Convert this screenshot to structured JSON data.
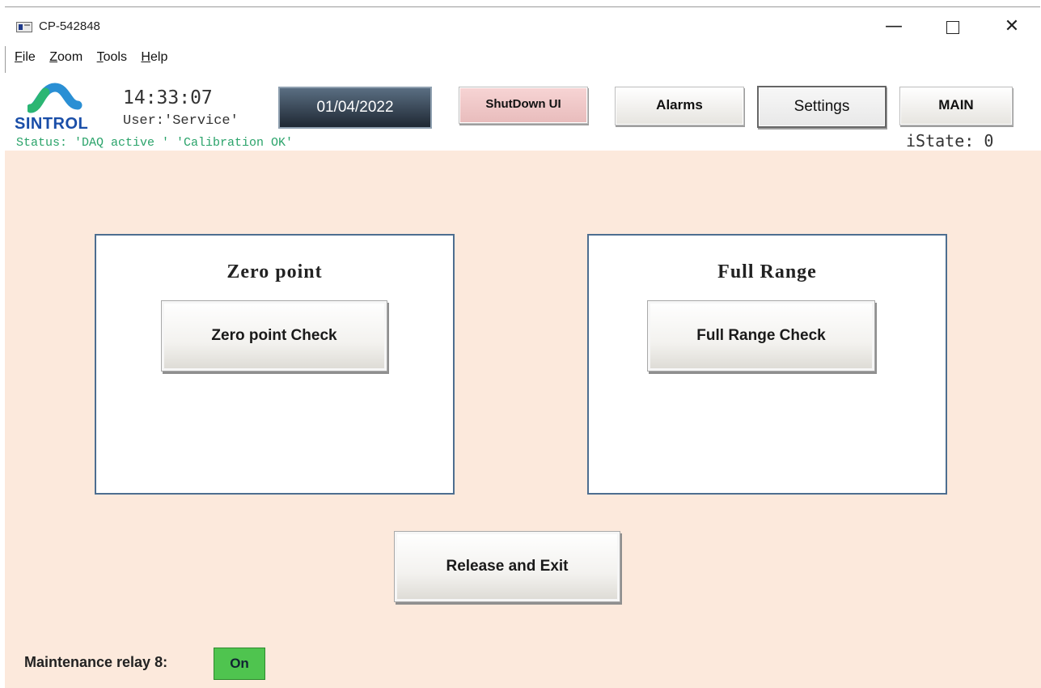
{
  "window": {
    "title": "CP-542848",
    "minimize_label": "—",
    "close_label": "✕"
  },
  "menu": [
    "File",
    "Zoom",
    "Tools",
    "Help"
  ],
  "header": {
    "logo_text": "SINTROL",
    "time": "14:33:07",
    "user": "User:'Service'",
    "status": "Status: 'DAQ active ' 'Calibration OK'",
    "istate": "iState: 0",
    "date": "01/04/2022",
    "buttons": {
      "shutdown": "ShutDown UI",
      "alarms": "Alarms",
      "settings": "Settings",
      "main": "MAIN"
    }
  },
  "panels": {
    "zero": {
      "title": "Zero point",
      "button": "Zero point Check"
    },
    "full": {
      "title": "Full Range",
      "button": "Full Range Check"
    }
  },
  "release_button": "Release and Exit",
  "relay": {
    "label": "Maintenance relay 8:",
    "state": "On"
  },
  "colors": {
    "background": "#fce9dc",
    "panel_border": "#4d6e90",
    "status_text": "#2aa36a",
    "relay_on": "#4fc44f",
    "shutdown_button": "#f7d4d4"
  }
}
